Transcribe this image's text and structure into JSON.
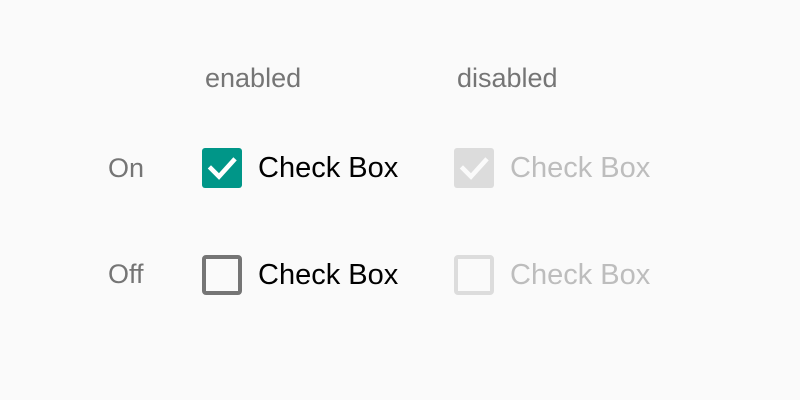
{
  "columns": {
    "enabled": "enabled",
    "disabled": "disabled"
  },
  "rows": {
    "on": "On",
    "off": "Off"
  },
  "checkboxes": {
    "on_enabled": {
      "label": "Check Box",
      "checked": true,
      "enabled": true
    },
    "on_disabled": {
      "label": "Check Box",
      "checked": true,
      "enabled": false
    },
    "off_enabled": {
      "label": "Check Box",
      "checked": false,
      "enabled": true
    },
    "off_disabled": {
      "label": "Check Box",
      "checked": false,
      "enabled": false
    }
  },
  "colors": {
    "background": "#fafafa",
    "accent": "#009688",
    "unchecked_border": "#757575",
    "disabled": "#dcdcdc",
    "disabled_text": "#bdbdbd",
    "header_text": "#757575",
    "label_text": "#000000"
  },
  "icons": {
    "checkmark": "check-icon"
  }
}
